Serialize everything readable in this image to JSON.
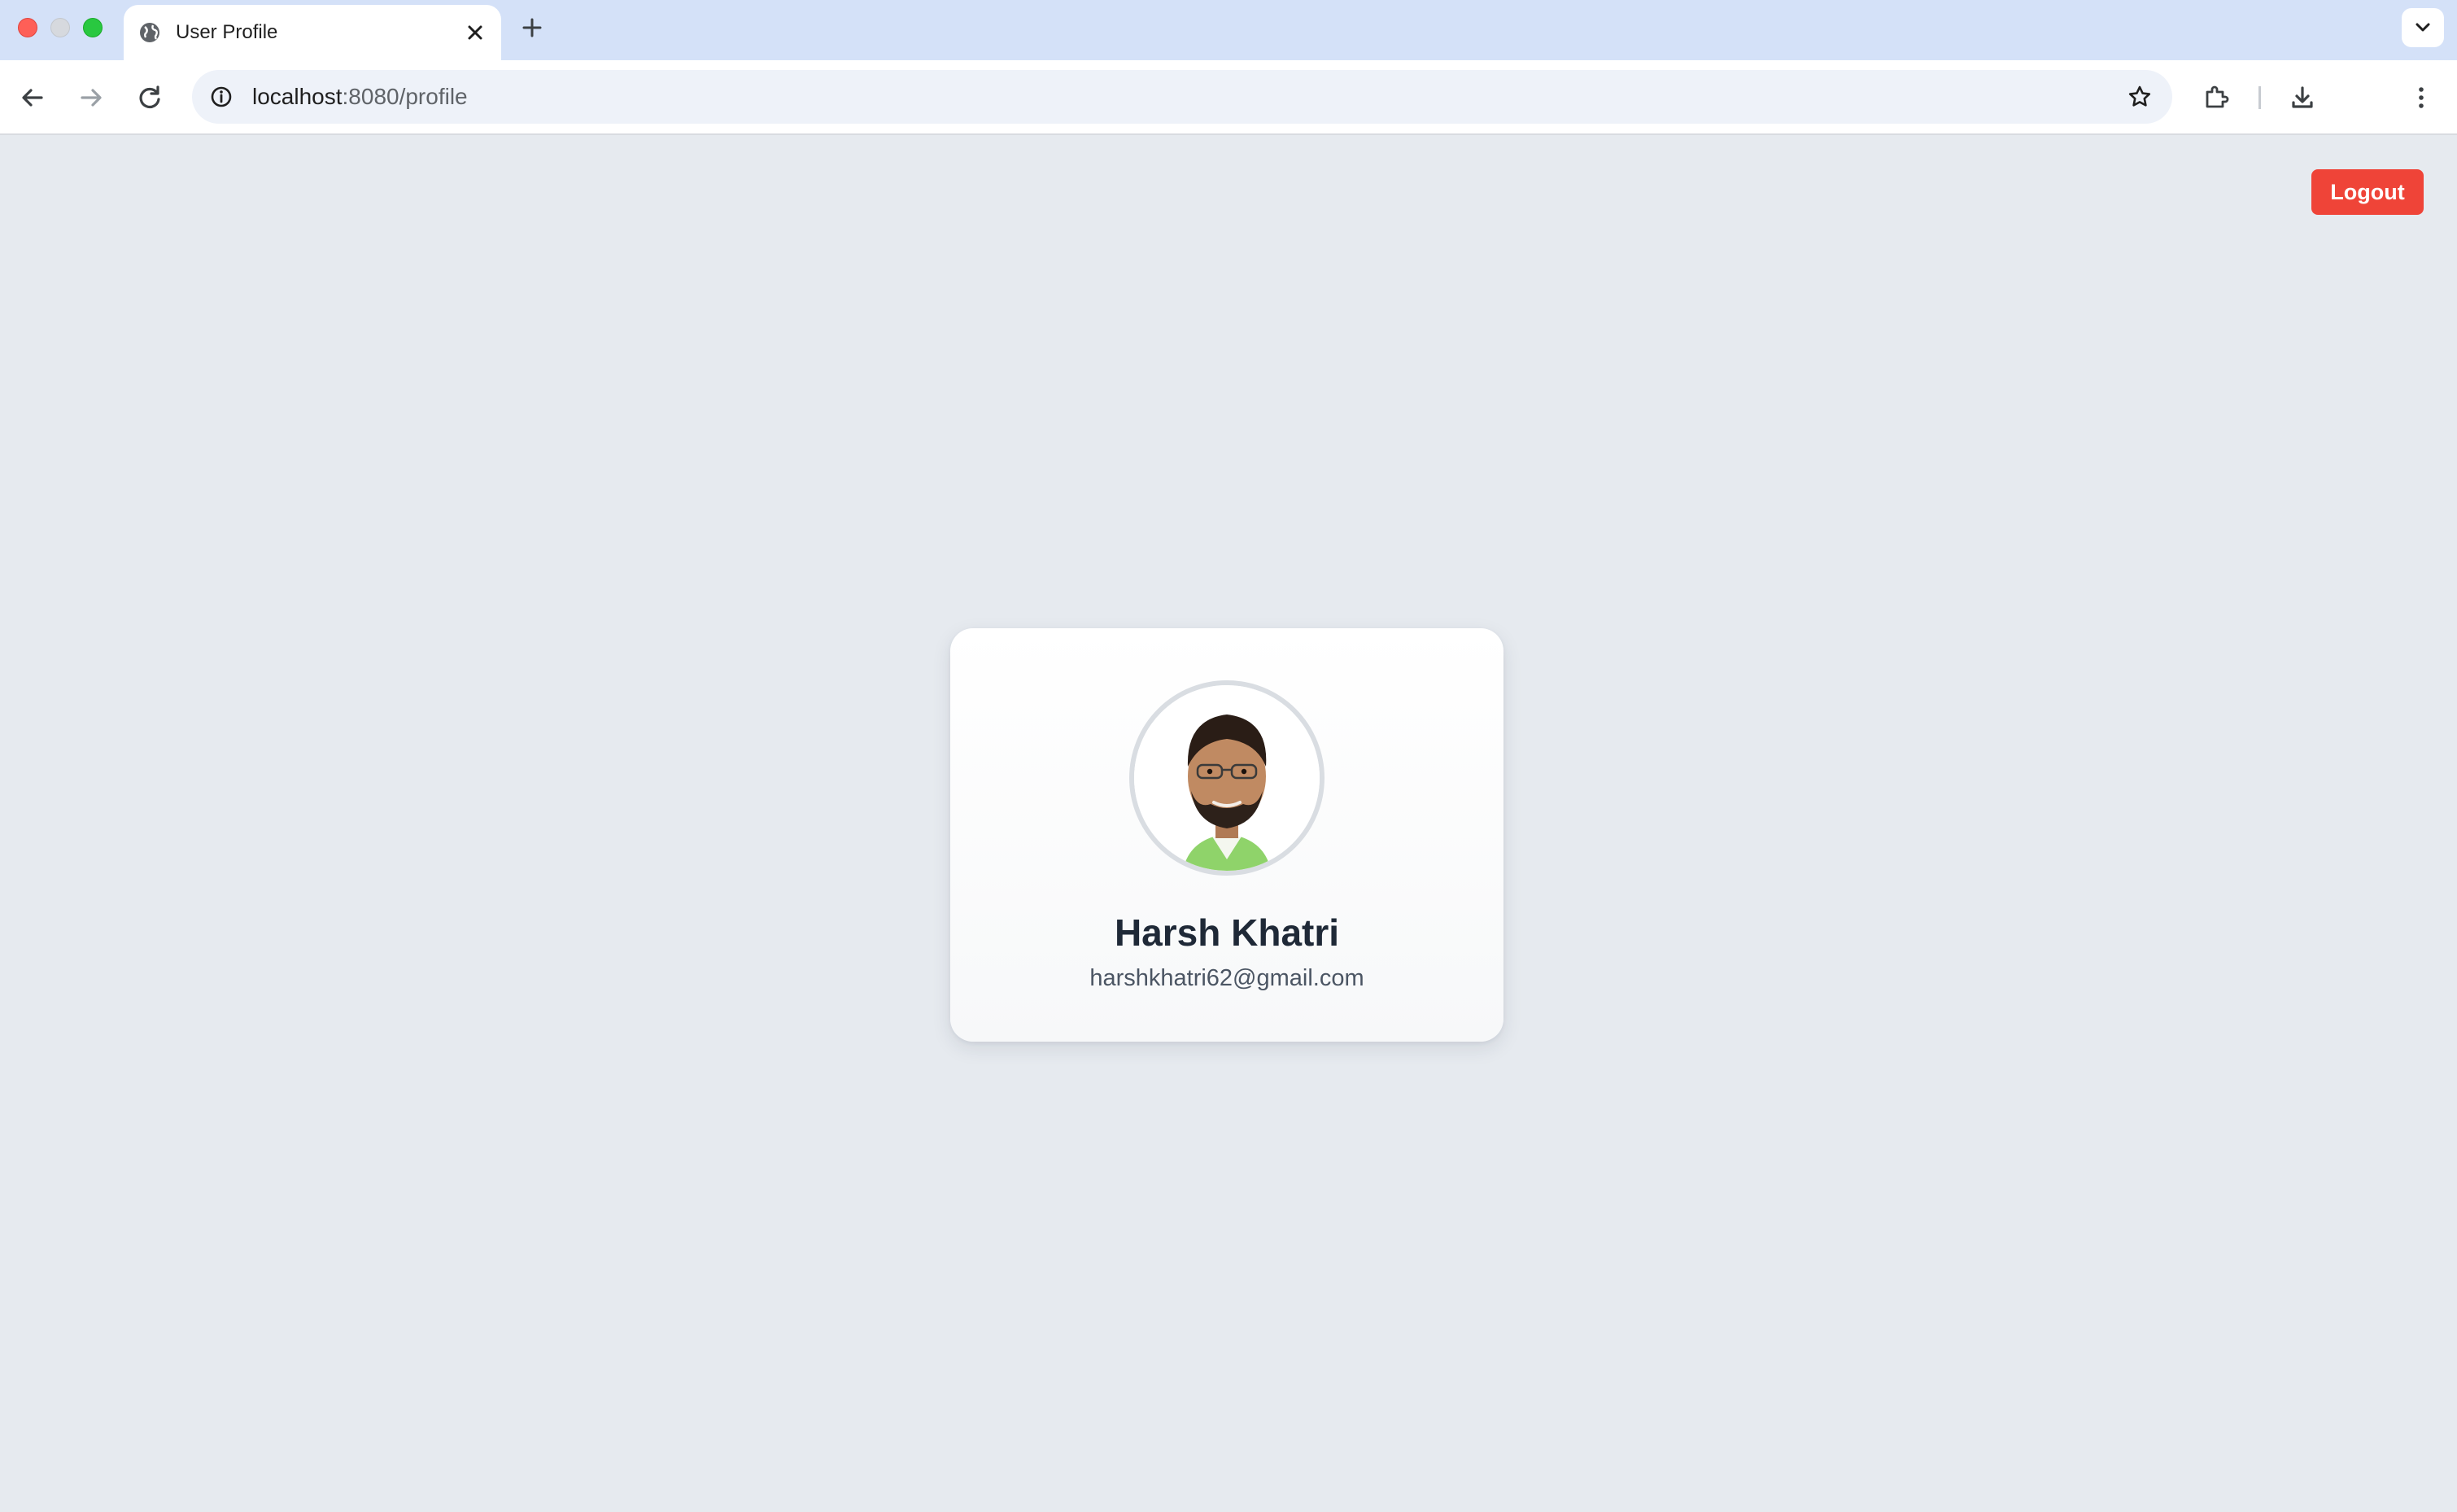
{
  "browser": {
    "tab": {
      "title": "User Profile",
      "icon": "globe-icon"
    },
    "address_bar": {
      "host": "localhost",
      "rest": ":8080/profile"
    },
    "window_controls": [
      "close",
      "minimize",
      "maximize"
    ]
  },
  "page": {
    "logout_label": "Logout",
    "profile": {
      "name": "Harsh Khatri",
      "email": "harshkhatri62@gmail.com",
      "avatar": "profile-photo"
    }
  },
  "colors": {
    "page_background": "#e6eaef",
    "logout_button": "#ef4438",
    "name_text": "#1f2937",
    "email_text": "#4b5563"
  }
}
